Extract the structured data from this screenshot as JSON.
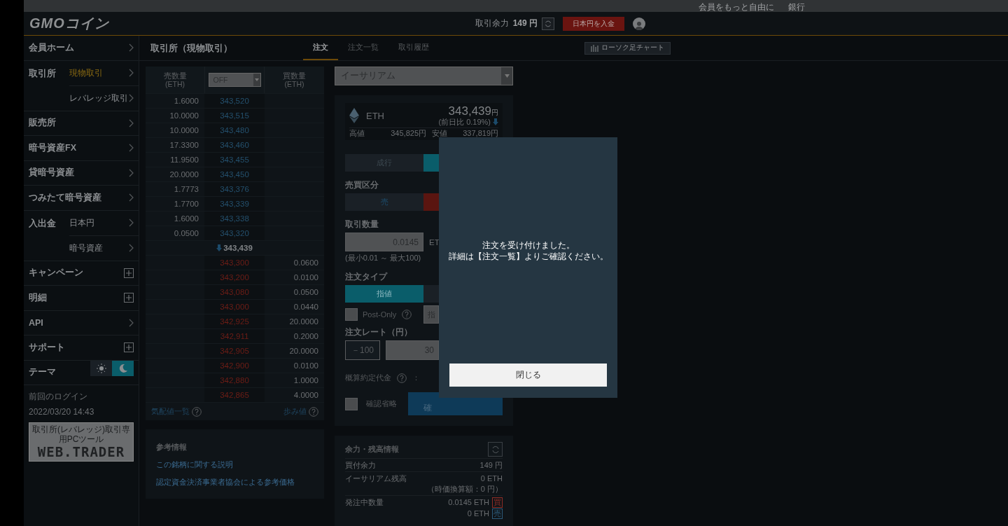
{
  "top_strip": {
    "texts": [
      "会員をもっと自由に",
      "銀行"
    ]
  },
  "header": {
    "logo": "GMOコイン",
    "balance_label": "取引余力",
    "balance_value": "149 円",
    "deposit_button": "日本円を入金"
  },
  "sidebar": {
    "items": [
      {
        "kind": "link",
        "label": "会員ホーム"
      },
      {
        "kind": "group",
        "label": "取引所",
        "children": [
          {
            "label": "現物取引",
            "selected": true
          },
          {
            "label": "レバレッジ取引",
            "selected": false
          }
        ]
      },
      {
        "kind": "link",
        "label": "販売所"
      },
      {
        "kind": "link",
        "label": "暗号資産FX"
      },
      {
        "kind": "link",
        "label": "貸暗号資産"
      },
      {
        "kind": "link",
        "label": "つみたて暗号資産"
      },
      {
        "kind": "group",
        "label": "入出金",
        "children": [
          {
            "label": "日本円",
            "selected": false
          },
          {
            "label": "暗号資産",
            "selected": false
          }
        ]
      },
      {
        "kind": "expand",
        "label": "キャンペーン"
      },
      {
        "kind": "expand",
        "label": "明細"
      },
      {
        "kind": "link",
        "label": "API"
      },
      {
        "kind": "expand",
        "label": "サポート"
      }
    ],
    "theme": {
      "label": "テーマ",
      "dark": true
    },
    "last_login": {
      "label": "前回のログイン",
      "value": "2022/03/20 14:43"
    },
    "banner": {
      "caption": "取引所(レバレッジ)取引専用PCツール",
      "title": "WEB.TRADER"
    }
  },
  "page": {
    "title": "取引所（現物取引）",
    "tabs": [
      {
        "label": "注文",
        "selected": true
      },
      {
        "label": "注文一覧",
        "selected": false
      },
      {
        "label": "取引履歴",
        "selected": false
      }
    ],
    "chart_button": "ローソク足チャート"
  },
  "order_book": {
    "sell_header": [
      "売数量",
      "(ETH)"
    ],
    "buy_header": [
      "買数量",
      "(ETH)"
    ],
    "filter": "OFF",
    "asks": [
      {
        "qty": "1.6000",
        "price": "343,520"
      },
      {
        "qty": "10.0000",
        "price": "343,515"
      },
      {
        "qty": "10.0000",
        "price": "343,480"
      },
      {
        "qty": "17.3300",
        "price": "343,460"
      },
      {
        "qty": "11.9500",
        "price": "343,455"
      },
      {
        "qty": "20.0000",
        "price": "343,450"
      },
      {
        "qty": "1.7773",
        "price": "343,376"
      },
      {
        "qty": "1.7700",
        "price": "343,339"
      },
      {
        "qty": "1.6000",
        "price": "343,338"
      },
      {
        "qty": "0.0500",
        "price": "343,320"
      }
    ],
    "last_price": "343,439",
    "falling": true,
    "bids": [
      {
        "price": "343,300",
        "qty": "0.0600"
      },
      {
        "price": "343,200",
        "qty": "0.0100"
      },
      {
        "price": "343,080",
        "qty": "0.0500"
      },
      {
        "price": "343,000",
        "qty": "0.0440"
      },
      {
        "price": "342,925",
        "qty": "20.0000"
      },
      {
        "price": "342,911",
        "qty": "0.2000"
      },
      {
        "price": "342,905",
        "qty": "20.0000"
      },
      {
        "price": "342,900",
        "qty": "0.0100"
      },
      {
        "price": "342,880",
        "qty": "1.0000"
      },
      {
        "price": "342,865",
        "qty": "4.0000"
      }
    ],
    "footer_links": [
      "気配値一覧",
      "歩み値"
    ]
  },
  "order_panel": {
    "symbol": "イーサリアム",
    "ticker": {
      "symbol": "ETH",
      "price": "343,439",
      "unit": "円",
      "change": "(前日比 0.19%)",
      "falling": true,
      "high_label": "高値",
      "high": "345,825円",
      "low_label": "安値",
      "low": "337,819円"
    },
    "mode_tabs": [
      {
        "label": "成行",
        "selected": false
      },
      {
        "selected": true
      }
    ],
    "side": {
      "label": "売買区分",
      "options": [
        {
          "label": "売",
          "kind": "sell",
          "selected": false
        },
        {
          "kind": "buy",
          "selected": true
        }
      ]
    },
    "quantity": {
      "label": "取引数量",
      "value": "0.0145",
      "unit": "ET",
      "range": "(最小0.01 ～ 最大100)"
    },
    "order_type": {
      "label": "注文タイプ",
      "options": [
        {
          "label": "指値",
          "selected": true
        },
        {
          "selected": false
        }
      ],
      "post_only": {
        "label": "Post-Only",
        "checked": false
      },
      "extra_button": "指"
    },
    "rate": {
      "label": "注文レート（円）",
      "step": "－100",
      "value": "30"
    },
    "estimate_label": "概算約定代金",
    "estimate_colon": "：",
    "confirm_skip": {
      "label": "確認省略",
      "checked": false
    },
    "submit": "確"
  },
  "reference": {
    "title": "参考情報",
    "links": [
      "この銘柄に関する説明",
      "認定資金決済事業者協会による参考価格"
    ]
  },
  "balance": {
    "title": "余力・残高情報",
    "rows": [
      {
        "label": "買付余力",
        "value": "149 円"
      },
      {
        "label": "イーサリアム残高",
        "value": "0 ETH",
        "note": "（時価換算額：0 円）"
      },
      {
        "label": "発注中数量",
        "value": "0.0145 ETH",
        "tag": "買",
        "buy": true
      },
      {
        "value": "0 ETH",
        "tag": "売",
        "buy": false
      }
    ]
  },
  "modal": {
    "message": [
      "注文を受け付けました。",
      "詳細は【注文一覧】よりご確認ください。"
    ],
    "button": "閉じる"
  }
}
